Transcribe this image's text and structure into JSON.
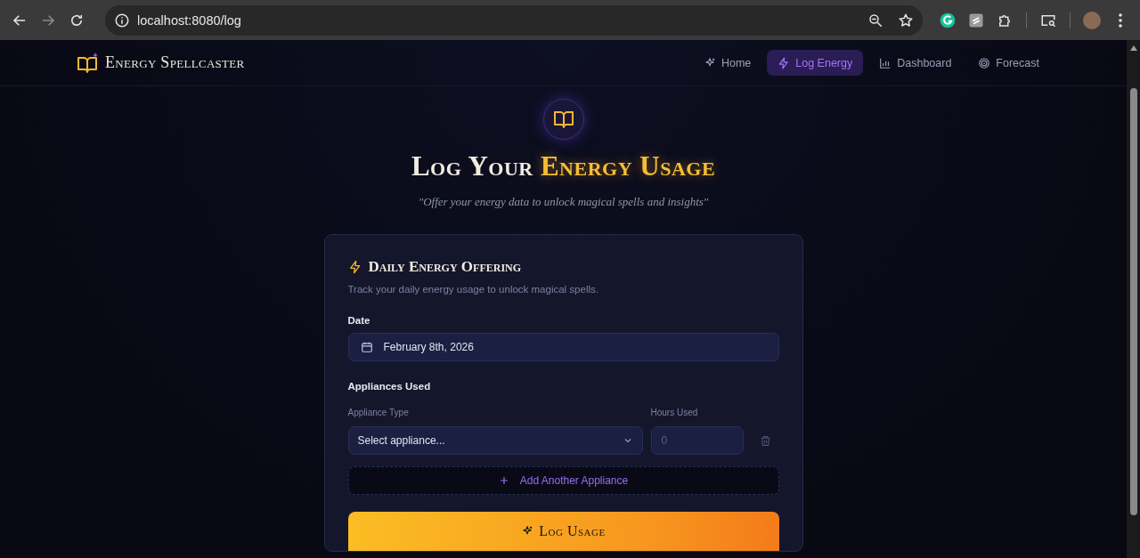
{
  "browser": {
    "url": "localhost:8080/log"
  },
  "site": {
    "brand": "Energy Spellcaster",
    "nav": [
      {
        "label": "Home",
        "selected": false
      },
      {
        "label": "Log Energy",
        "selected": true
      },
      {
        "label": "Dashboard",
        "selected": false
      },
      {
        "label": "Forecast",
        "selected": false
      }
    ]
  },
  "hero": {
    "title_lead": "Log Your",
    "title_highlight": "Energy Usage",
    "subtitle": "\"Offer your energy data to unlock magical spells and insights\""
  },
  "card": {
    "title": "Daily Energy Offering",
    "description": "Track your daily energy usage to unlock magical spells.",
    "date_label": "Date",
    "date_value": "February 8th, 2026",
    "appliances_label": "Appliances Used",
    "type_label": "Appliance Type",
    "hours_label": "Hours Used",
    "appliances": [
      {
        "type": "Select appliance...",
        "hours_placeholder": "0"
      }
    ],
    "add_button": "Add Another Appliance",
    "submit_button": "Log Usage"
  }
}
